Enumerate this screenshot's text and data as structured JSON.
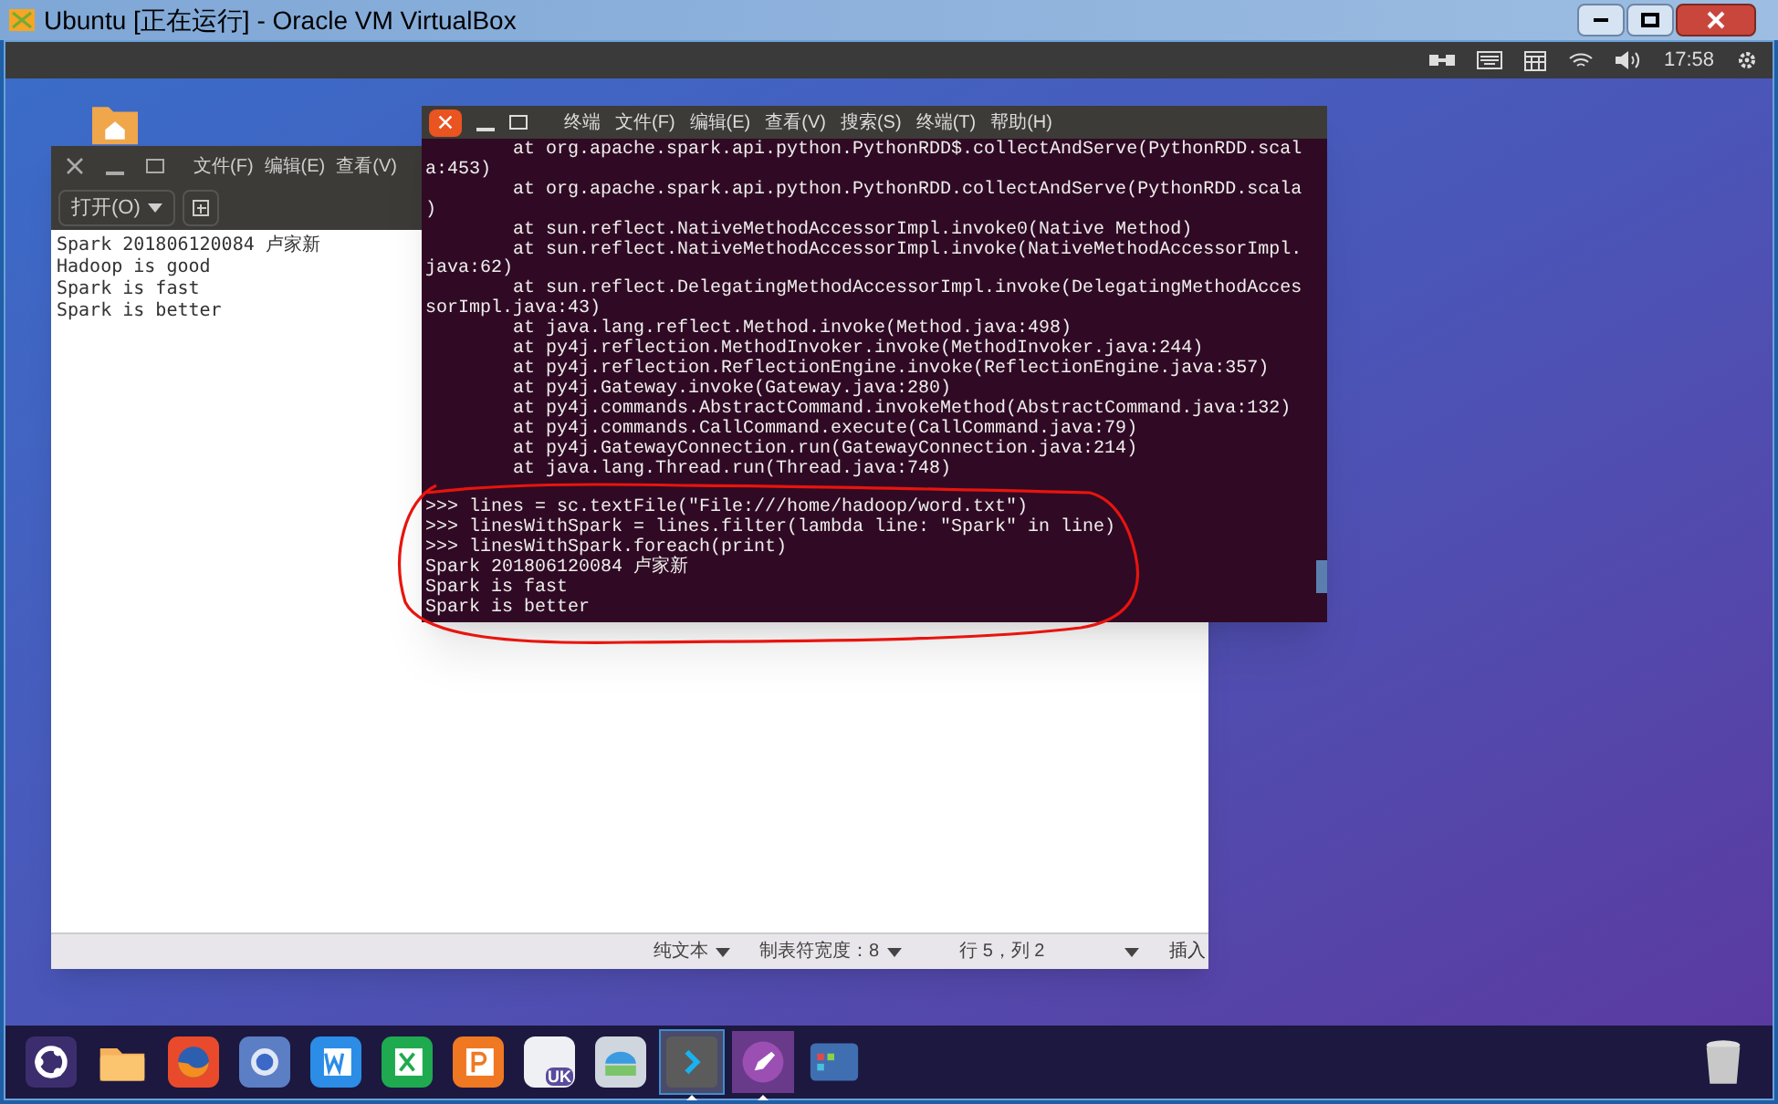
{
  "host_window": {
    "title": "Ubuntu [正在运行] - Oracle VM VirtualBox"
  },
  "top_panel": {
    "clock": "17:58"
  },
  "editor": {
    "menu": [
      "文件(F)",
      "编辑(E)",
      "查看(V)"
    ],
    "open_button": "打开(O)",
    "lines": [
      "Spark 201806120084 卢家新",
      "Hadoop is good",
      "Spark is fast",
      "Spark is better"
    ],
    "status_bar": {
      "syntax": "纯文本",
      "tab_width": "制表符宽度：8",
      "position": "行 5，列 2",
      "mode": "插入"
    }
  },
  "terminal": {
    "menu": [
      "终端",
      "文件(F)",
      "编辑(E)",
      "查看(V)",
      "搜索(S)",
      "终端(T)",
      "帮助(H)"
    ],
    "lines": [
      "        at org.apache.spark.api.python.PythonRDD$.collectAndServe(PythonRDD.scal",
      "a:453)",
      "        at org.apache.spark.api.python.PythonRDD.collectAndServe(PythonRDD.scala",
      ")",
      "        at sun.reflect.NativeMethodAccessorImpl.invoke0(Native Method)",
      "        at sun.reflect.NativeMethodAccessorImpl.invoke(NativeMethodAccessorImpl.",
      "java:62)",
      "        at sun.reflect.DelegatingMethodAccessorImpl.invoke(DelegatingMethodAcces",
      "sorImpl.java:43)",
      "        at java.lang.reflect.Method.invoke(Method.java:498)",
      "        at py4j.reflection.MethodInvoker.invoke(MethodInvoker.java:244)",
      "        at py4j.reflection.ReflectionEngine.invoke(ReflectionEngine.java:357)",
      "        at py4j.Gateway.invoke(Gateway.java:280)",
      "        at py4j.commands.AbstractCommand.invokeMethod(AbstractCommand.java:132)",
      "        at py4j.commands.CallCommand.execute(CallCommand.java:79)",
      "        at py4j.GatewayConnection.run(GatewayConnection.java:214)",
      "        at java.lang.Thread.run(Thread.java:748)",
      ">>> lines = sc.textFile(\"File:///home/hadoop/word.txt\")",
      ">>> linesWithSpark = lines.filter(lambda line: \"Spark\" in line)",
      ">>> linesWithSpark.foreach(print)",
      "Spark 201806120084 卢家新",
      "Spark is fast",
      "Spark is better"
    ]
  },
  "dock": [
    {
      "kind": "ubuntu",
      "running": false,
      "selected": false
    },
    {
      "kind": "folder",
      "running": false,
      "selected": false
    },
    {
      "kind": "firefox",
      "running": false,
      "selected": false
    },
    {
      "kind": "chromium",
      "running": false,
      "selected": false
    },
    {
      "kind": "word",
      "running": false,
      "selected": false
    },
    {
      "kind": "excel",
      "running": false,
      "selected": false
    },
    {
      "kind": "powerpoint",
      "running": false,
      "selected": false
    },
    {
      "kind": "store",
      "label": "UK",
      "running": false,
      "selected": false
    },
    {
      "kind": "scanner",
      "running": false,
      "selected": false
    },
    {
      "kind": "terminal",
      "running": true,
      "selected": true
    },
    {
      "kind": "editor",
      "running": true,
      "selected": false
    },
    {
      "kind": "window",
      "running": false,
      "selected": false
    }
  ]
}
